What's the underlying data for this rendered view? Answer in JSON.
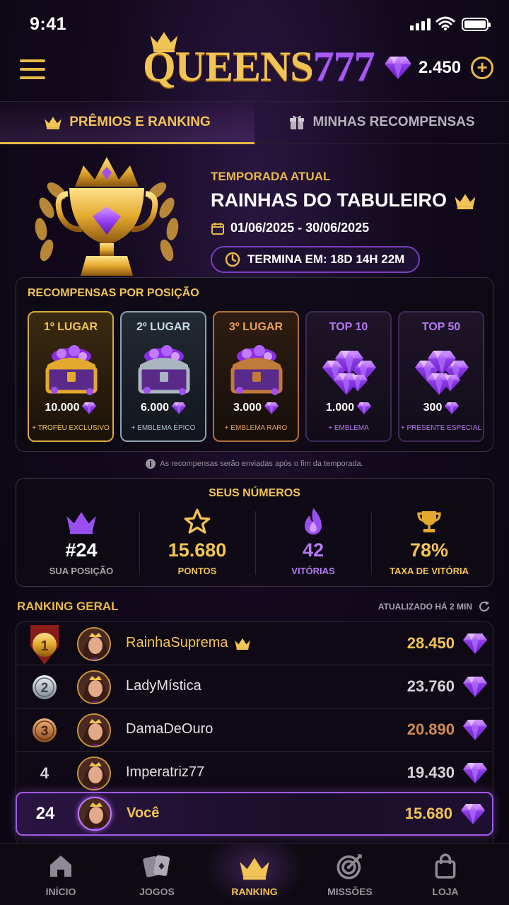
{
  "status_bar": {
    "time": "9:41"
  },
  "header": {
    "logo_text": "QUEENS",
    "logo_number": "777",
    "gem_balance": "2.450"
  },
  "tabs": [
    {
      "label": "PRÊMIOS E RANKING",
      "active": true
    },
    {
      "label": "MINHAS RECOMPENSAS",
      "active": false
    }
  ],
  "season": {
    "label": "TEMPORADA ATUAL",
    "title": "RAINHAS DO TABULEIRO",
    "dates": "01/06/2025 - 30/06/2025",
    "ends": "TERMINA EM: 18D 14H 22M"
  },
  "rewards": {
    "heading": "RECOMPENSAS POR POSIÇÃO",
    "cards": [
      {
        "title": "1º LUGAR",
        "value": "10.000",
        "bonus": "+ TROFÉU EXCLUSIVO",
        "icon": "gold-chest-icon"
      },
      {
        "title": "2º LUGAR",
        "value": "6.000",
        "bonus": "+ EMBLEMA ÉPICO",
        "icon": "silver-chest-icon"
      },
      {
        "title": "3º LUGAR",
        "value": "3.000",
        "bonus": "+ EMBLEMA RARO",
        "icon": "bronze-chest-icon"
      },
      {
        "title": "TOP 10",
        "value": "1.000",
        "bonus": "+ EMBLEMA",
        "icon": "gem-pile-icon"
      },
      {
        "title": "TOP 50",
        "value": "300",
        "bonus": "+ PRESENTE ESPECIAL",
        "icon": "gem-pile-icon"
      }
    ]
  },
  "note": "As recompensas serão enviadas após o fim da temporada.",
  "stats": {
    "heading": "SEUS NÚMEROS",
    "items": [
      {
        "value": "#24",
        "label": "SUA POSIÇÃO",
        "icon": "crown-icon",
        "color": "#ffffff"
      },
      {
        "value": "15.680",
        "label": "PONTOS",
        "icon": "star-icon",
        "color": "#f2c455"
      },
      {
        "value": "42",
        "label": "VITÓRIAS",
        "icon": "flame-icon",
        "color": "#b57af2"
      },
      {
        "value": "78%",
        "label": "TAXA DE VITÓRIA",
        "icon": "trophy-icon",
        "color": "#f2c455"
      }
    ]
  },
  "ranking": {
    "heading": "RANKING GERAL",
    "updated": "ATUALIZADO HÁ 2 MIN",
    "rows": [
      {
        "pos": "1",
        "name": "RainhaSuprema",
        "points": "28.450",
        "color": "#f2c455"
      },
      {
        "pos": "2",
        "name": "LadyMística",
        "points": "23.760",
        "color": "#d6d2da"
      },
      {
        "pos": "3",
        "name": "DamaDeOuro",
        "points": "20.890",
        "color": "#d38b55"
      },
      {
        "pos": "4",
        "name": "Imperatriz77",
        "points": "19.430",
        "color": "#d6d2da"
      }
    ],
    "you": {
      "pos": "24",
      "name": "Você",
      "points": "15.680"
    }
  },
  "nav": [
    {
      "label": "INÍCIO"
    },
    {
      "label": "JOGOS"
    },
    {
      "label": "RANKING"
    },
    {
      "label": "MISSÕES"
    },
    {
      "label": "LOJA"
    }
  ],
  "colors": {
    "gold": "#e9b948",
    "purple": "#a05be8",
    "bg": "#0b0710"
  }
}
